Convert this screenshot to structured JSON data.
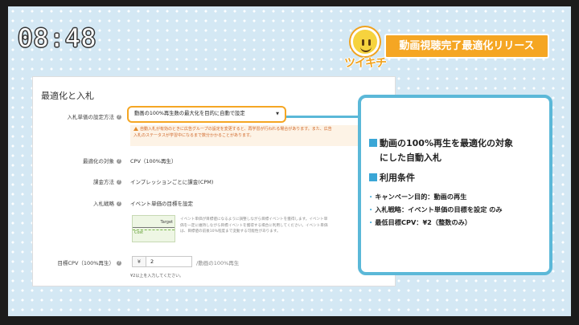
{
  "clock": "08:48",
  "logo": {
    "text": "ツイキチ"
  },
  "banner_title": "動画視聴完了最適化リリース",
  "panel": {
    "title": "最適化と入札",
    "bid_method_label": "入札単価の設定方法",
    "bid_method_value": "動画の100%再生数の最大化を目的に自動で設定",
    "warning_line1": "自動入札が有効のときに広告グループの設定を変更すると、再学習が行われる場合があります。また、広告",
    "warning_line2": "入札のステータスが学習中になるまで数分かかることがあります。",
    "optimize_label": "最適化の対象",
    "optimize_value": "CPV（100%再生）",
    "billing_label": "課金方法",
    "billing_value": "インプレッションごとに課金(CPM)",
    "strategy_label": "入札戦略",
    "strategy_value": "イベント単価の目標を設定",
    "graph_target": "Target",
    "graph_cost": "Cost",
    "strategy_desc_1": "イベント単価が目標値になるように調整しながら目標イベントを獲得します。イベント単",
    "strategy_desc_2": "価を一定に維持しながら目標イベントを獲得する場合に利用してください。イベント単価",
    "strategy_desc_3": "は、目標値の前後10%程度まで変動する可能性があります。",
    "cpv_label": "目標CPV（100%再生）",
    "currency": "¥",
    "cpv_value": "2",
    "cpv_unit": "/動画の100%再生",
    "cpv_hint": "¥2以上を入力してください。"
  },
  "callout": {
    "heading_line1": "動画の100%再生を最適化の対象",
    "heading_line2": "にした自動入札",
    "heading2": "利用条件",
    "cond1": "キャンペーン目的：動画の再生",
    "cond2": "入札戦略：イベント単価の目標を設定 のみ",
    "cond3": "最低目標CPV：¥2（整数のみ）"
  },
  "colors": {
    "accent_orange": "#f5a623",
    "callout_blue": "#5bb8d8",
    "square_blue": "#3aa6d6"
  }
}
